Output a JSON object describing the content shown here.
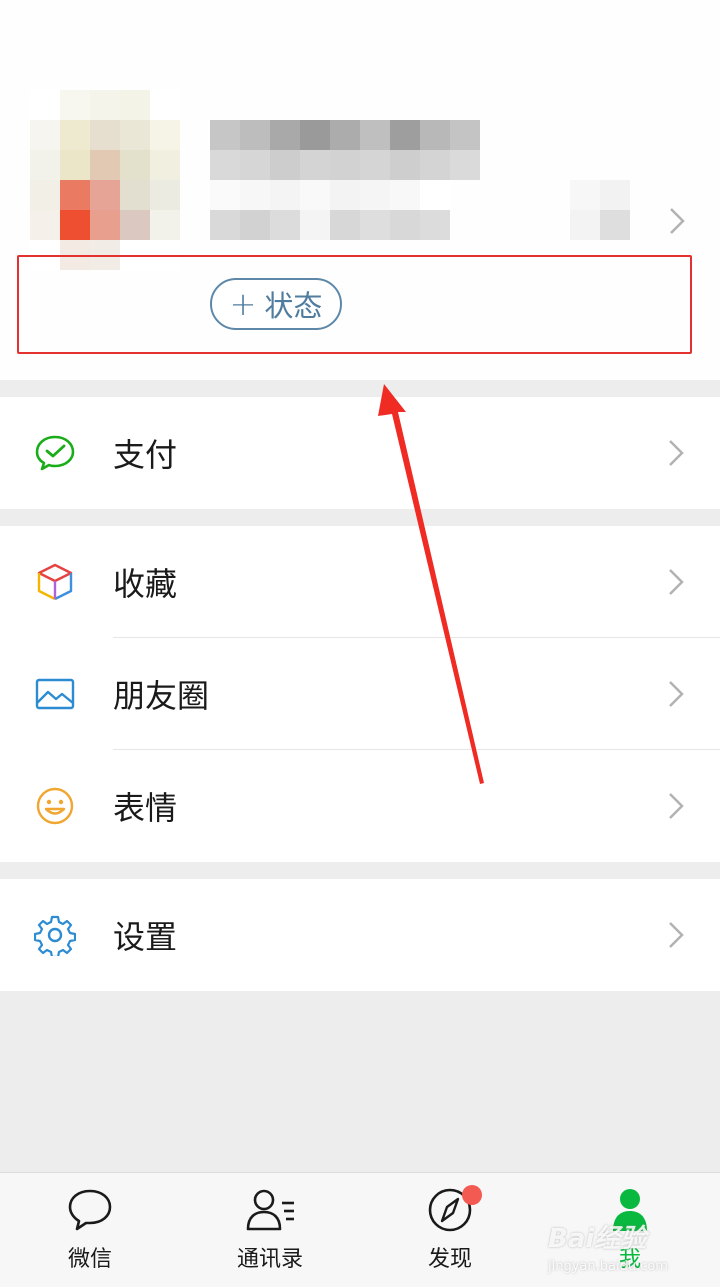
{
  "profile": {
    "status_label": "状态",
    "status_plus": "+"
  },
  "menu": {
    "pay": {
      "label": "支付",
      "icon": "wechat-pay-icon"
    },
    "favorites": {
      "label": "收藏",
      "icon": "favorites-cube-icon"
    },
    "moments": {
      "label": "朋友圈",
      "icon": "album-icon"
    },
    "stickers": {
      "label": "表情",
      "icon": "smiley-icon"
    },
    "settings": {
      "label": "设置",
      "icon": "gear-icon"
    }
  },
  "tabs": [
    {
      "label": "微信",
      "icon": "chat-bubble-icon",
      "active": false
    },
    {
      "label": "通讯录",
      "icon": "contacts-icon",
      "active": false
    },
    {
      "label": "发现",
      "icon": "compass-icon",
      "active": false,
      "badge": true
    },
    {
      "label": "我",
      "icon": "person-icon",
      "active": true
    }
  ],
  "watermark": {
    "brand": "Bai经验",
    "url": "jingyan.baidu.com"
  },
  "colors": {
    "accent_green": "#09b83e",
    "highlight_red": "#e3312f",
    "status_blue": "#4f7c9f",
    "badge_red": "#f35a52"
  }
}
